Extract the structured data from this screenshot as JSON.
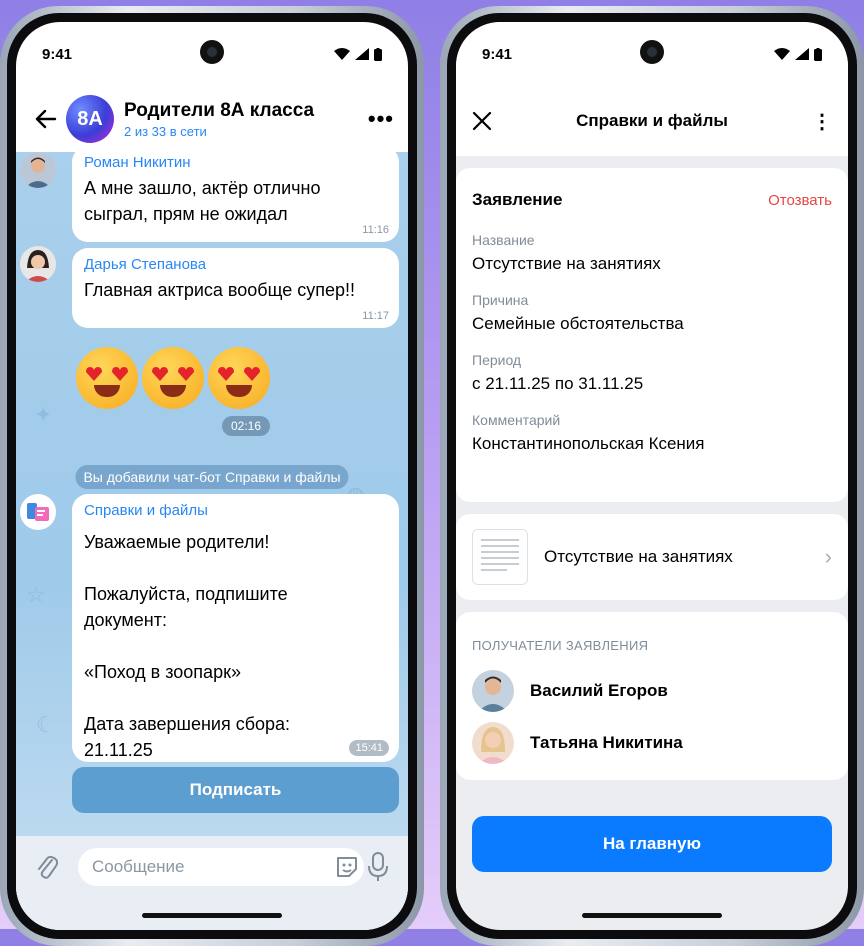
{
  "colors": {
    "accent": "#2787f5",
    "primary_button": "#0a7aff",
    "danger": "#e64646",
    "chat_bg": "#a9d0ec"
  },
  "status_bar": {
    "time": "9:41"
  },
  "chat": {
    "header": {
      "title": "Родители 8А класса",
      "subtitle": "2 из 33 в сети",
      "avatar_text": "8А",
      "back_icon": "arrow-left-icon",
      "more_icon": "more-horizontal-icon"
    },
    "messages": [
      {
        "author": "Роман Никитин",
        "text": "А мне зашло, актёр отлично сыграл, прям не ожидал",
        "time": "11:16"
      },
      {
        "author": "Дарья Степанова",
        "text": "Главная актриса вообще супер!!",
        "time": "11:17"
      }
    ],
    "emoji_message": {
      "emojis": [
        "😍",
        "😍",
        "😍"
      ],
      "time": "02:16"
    },
    "system_message": "Вы добавили чат-бот Справки и файлы",
    "bot_message": {
      "author": "Справки и файлы",
      "lines": [
        "Уважаемые родители!",
        "",
        "Пожалуйста, подпишите документ:",
        "",
        "«Поход в зоопарк»",
        "",
        "Дата завершения сбора: 21.11.25"
      ],
      "time": "15:41"
    },
    "sign_button": "Подписать",
    "composer": {
      "placeholder": "Сообщение",
      "attach_icon": "paperclip-icon",
      "sticker_icon": "sticker-icon",
      "mic_icon": "microphone-icon"
    }
  },
  "form": {
    "header": {
      "title": "Справки и файлы",
      "close_icon": "close-icon",
      "menu_icon": "more-vertical-icon"
    },
    "application": {
      "title": "Заявление",
      "revoke": "Отозвать",
      "fields": [
        {
          "label": "Название",
          "value": "Отсутствие на занятиях"
        },
        {
          "label": "Причина",
          "value": "Семейные обстоятельства"
        },
        {
          "label": "Период",
          "value": "с 21.11.25 по 31.11.25"
        },
        {
          "label": "Комментарий",
          "value": "Константинопольская Ксения"
        }
      ]
    },
    "document": {
      "name": "Отсутствие на занятиях",
      "chevron_icon": "chevron-right-icon"
    },
    "recipients": {
      "caption": "ПОЛУЧАТЕЛИ ЗАЯВЛЕНИЯ",
      "items": [
        {
          "name": "Василий Егоров"
        },
        {
          "name": "Татьяна Никитина"
        }
      ]
    },
    "home_button": "На главную"
  }
}
